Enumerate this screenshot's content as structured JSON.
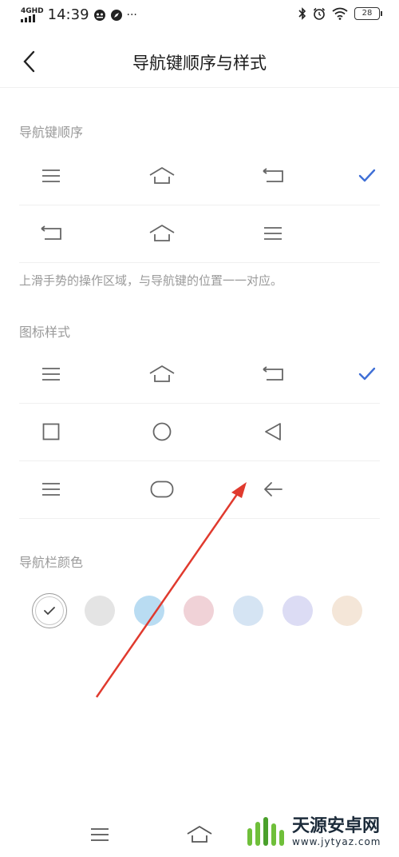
{
  "status_bar": {
    "network": "4GHD",
    "time": "14:39",
    "more": "···",
    "battery": "28"
  },
  "header": {
    "title": "导航键顺序与样式"
  },
  "sections": {
    "nav_order": {
      "label": "导航键顺序",
      "options": [
        {
          "icons": [
            "menu-icon",
            "home-icon",
            "back-icon"
          ],
          "selected": true
        },
        {
          "icons": [
            "back-icon",
            "home-icon",
            "menu-icon"
          ],
          "selected": false
        }
      ],
      "hint": "上滑手势的操作区域，与导航键的位置一一对应。"
    },
    "icon_style": {
      "label": "图标样式",
      "options": [
        {
          "icons": [
            "menu-icon",
            "home-icon",
            "back-icon"
          ],
          "selected": true
        },
        {
          "icons": [
            "square-icon",
            "circle-icon",
            "triangle-icon"
          ],
          "selected": false
        },
        {
          "icons": [
            "menu-icon",
            "rounded-rect-icon",
            "arrow-left-icon"
          ],
          "selected": false
        }
      ]
    },
    "nav_color": {
      "label": "导航栏颜色",
      "swatches": [
        "#ffffff",
        "#e4e4e4",
        "#b9dcf2",
        "#f0d2d7",
        "#d5e4f3",
        "#dcdcf4",
        "#f4e6d8"
      ],
      "selected_index": 0
    }
  },
  "accent_color": "#3f6fd6",
  "watermark": {
    "title": "天源安卓网",
    "url": "www.jytyaz.com"
  }
}
